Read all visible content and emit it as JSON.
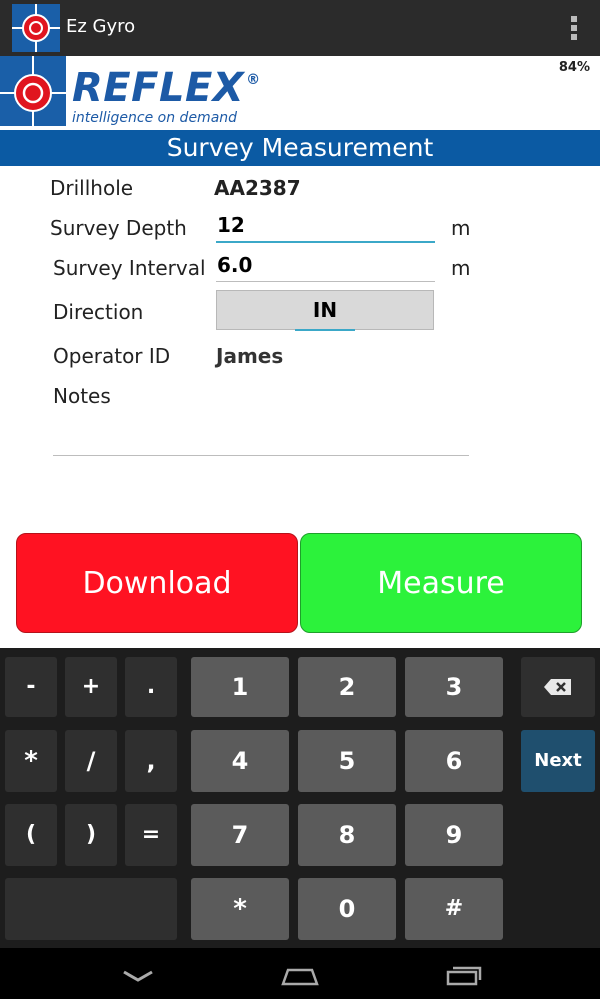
{
  "app": {
    "title": "Ez Gyro",
    "battery": "84%"
  },
  "brand": {
    "name": "REFLEX",
    "registered": "®",
    "tagline": "intelligence on demand"
  },
  "screen_title": "Survey Measurement",
  "form": {
    "drillhole": {
      "label": "Drillhole",
      "value": "AA2387"
    },
    "survey_depth": {
      "label": "Survey Depth",
      "value": "12",
      "unit": "m"
    },
    "survey_interval": {
      "label": "Survey Interval",
      "value": "6.0",
      "unit": "m"
    },
    "direction": {
      "label": "Direction",
      "value": "IN"
    },
    "operator_id": {
      "label": "Operator ID",
      "value": "James"
    },
    "notes": {
      "label": "Notes",
      "value": ""
    }
  },
  "buttons": {
    "download": "Download",
    "measure": "Measure"
  },
  "keyboard": {
    "row1": [
      "-",
      "+",
      ".",
      "1",
      "2",
      "3"
    ],
    "row2": [
      "*",
      "/",
      ",",
      "4",
      "5",
      "6",
      "Next"
    ],
    "row3": [
      "(",
      ")",
      "=",
      "7",
      "8",
      "9"
    ],
    "row4": [
      "*",
      "0",
      "#"
    ],
    "backspace_icon": "backspace-icon"
  },
  "nav": {
    "back_icon": "back-icon",
    "home_icon": "home-icon",
    "recents_icon": "recents-icon"
  },
  "colors": {
    "brand_blue": "#0b5aa3",
    "download_red": "#ff1222",
    "measure_green": "#2cf23b",
    "focus_cyan": "#3ba8c8"
  }
}
